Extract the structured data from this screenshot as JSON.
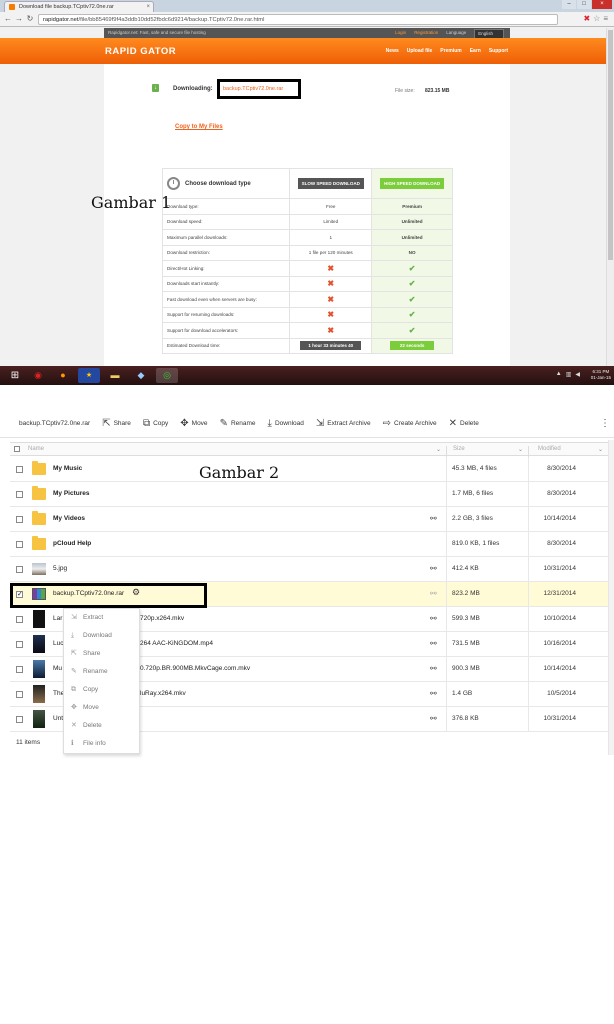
{
  "captions": {
    "first": "Gambar 1",
    "second": "Gambar 2"
  },
  "browser": {
    "tab_title": "Download file backup.TCptiv72.0ne.rar",
    "url_domain": "rapidgator.net",
    "url_path": "/file/bb85469f9f4a3ddb10dd52fbdc6d9214/backup.TCptiv72.0ne.rar.html"
  },
  "rapidgator": {
    "tagline": "Rapidgator.net: Fast, safe and secure file hosting",
    "login": "Login",
    "registration": "Registration",
    "language_label": "Language",
    "language_value": "English",
    "logo": "RAPID GATOR",
    "menu": [
      "News",
      "Upload file",
      "Premium",
      "Earn",
      "Support"
    ],
    "downloading_label": "Downloading:",
    "filename": "backup.TCptiv72.0ne.rar",
    "file_size_label": "File size:",
    "file_size": "823.15 MB",
    "copy_link": "Copy to My Files",
    "choose_label": "Choose download type",
    "slow_btn": "SLOW SPEED DOWNLOAD",
    "fast_btn": "HIGH SPEED DOWNLOAD",
    "rows": [
      {
        "label": "Download type:",
        "free": "Free",
        "premium": "Premium"
      },
      {
        "label": "Download speed:",
        "free": "Limited",
        "premium": "Unlimited"
      },
      {
        "label": "Maximum parallel downloads:",
        "free": "1",
        "premium": "Unlimited"
      },
      {
        "label": "Download restriction:",
        "free": "1 file per 120 minutes",
        "premium": "NO"
      },
      {
        "label": "Direct/Hot Linking:",
        "free": "✖",
        "premium": "✔"
      },
      {
        "label": "Downloads start instantly:",
        "free": "✖",
        "premium": "✔"
      },
      {
        "label": "Fast download even when servers are busy:",
        "free": "✖",
        "premium": "✔"
      },
      {
        "label": "Support for resuming downloads:",
        "free": "✖",
        "premium": "✔"
      },
      {
        "label": "Support for download accelerators:",
        "free": "✖",
        "premium": "✔"
      }
    ],
    "estimated_label": "Estimated Download time:",
    "estimated_free": "1 hour 33 minutes 40",
    "estimated_premium": "22 seconds"
  },
  "taskbar": {
    "time": "6:31 PM",
    "date": "01-Jan-15"
  },
  "pcloud": {
    "selected_file": "backup.TCptiv72.0ne.rar",
    "actions": [
      {
        "icon": "share-icon",
        "glyph": "⇱",
        "label": "Share"
      },
      {
        "icon": "copy-icon",
        "glyph": "⧉",
        "label": "Copy"
      },
      {
        "icon": "move-icon",
        "glyph": "✥",
        "label": "Move"
      },
      {
        "icon": "rename-icon",
        "glyph": "✎",
        "label": "Rename"
      },
      {
        "icon": "download-icon",
        "glyph": "⤓",
        "label": "Download"
      },
      {
        "icon": "extract-archive-icon",
        "glyph": "⇲",
        "label": "Extract Archive"
      },
      {
        "icon": "create-archive-icon",
        "glyph": "⇨",
        "label": "Create Archive"
      },
      {
        "icon": "delete-icon",
        "glyph": "✕",
        "label": "Delete"
      }
    ],
    "columns": {
      "name": "Name",
      "size": "Size",
      "modified": "Modified"
    },
    "files": [
      {
        "name": "My Music",
        "type": "folder",
        "shared": false,
        "size": "45.3 MB, 4 files",
        "modified": "8/30/2014"
      },
      {
        "name": "My Pictures",
        "type": "folder",
        "shared": false,
        "size": "1.7 MB, 6 files",
        "modified": "8/30/2014"
      },
      {
        "name": "My Videos",
        "type": "folder",
        "shared": true,
        "size": "2.2 GB, 3 files",
        "modified": "10/14/2014"
      },
      {
        "name": "pCloud Help",
        "type": "folder",
        "shared": false,
        "size": "819.0 KB, 1 files",
        "modified": "8/30/2014"
      },
      {
        "name": "5.jpg",
        "type": "image",
        "shared": true,
        "size": "412.4 KB",
        "modified": "10/31/2014"
      },
      {
        "name": "backup.TCptiv72.0ne.rar",
        "type": "rar",
        "shared": true,
        "selected": true,
        "size": "823.2 MB",
        "modified": "12/31/2014"
      },
      {
        "name": "Lar",
        "name_rest": "720p.x264.mkv",
        "type": "video",
        "shared": true,
        "size": "599.3 MB",
        "modified": "10/10/2014"
      },
      {
        "name": "Luc",
        "name_rest": "264 AAC-KiNGDOM.mp4",
        "type": "video",
        "shared": true,
        "size": "731.5 MB",
        "modified": "10/16/2014"
      },
      {
        "name": "Mu",
        "name_rest": "0.720p.BR.900MB.MkvCage.com.mkv",
        "type": "video",
        "shared": true,
        "size": "900.3 MB",
        "modified": "10/14/2014"
      },
      {
        "name": "The",
        "name_rest": "luRay.x264.mkv",
        "type": "video",
        "shared": true,
        "size": "1.4 GB",
        "modified": "10/5/2014"
      },
      {
        "name": "Unt",
        "name_rest": "",
        "type": "video",
        "shared": true,
        "size": "376.8 KB",
        "modified": "10/31/2014"
      }
    ],
    "context_menu": [
      {
        "icon": "extract-icon",
        "glyph": "⇲",
        "label": "Extract"
      },
      {
        "icon": "download-icon",
        "glyph": "⤓",
        "label": "Download"
      },
      {
        "icon": "share-icon",
        "glyph": "⇱",
        "label": "Share"
      },
      {
        "icon": "rename-icon",
        "glyph": "✎",
        "label": "Rename"
      },
      {
        "icon": "copy-icon",
        "glyph": "⧉",
        "label": "Copy"
      },
      {
        "icon": "move-icon",
        "glyph": "✥",
        "label": "Move"
      },
      {
        "icon": "delete-icon",
        "glyph": "✕",
        "label": "Delete"
      },
      {
        "icon": "info-icon",
        "glyph": "ℹ",
        "label": "File info"
      }
    ],
    "items_count": "11 items"
  }
}
